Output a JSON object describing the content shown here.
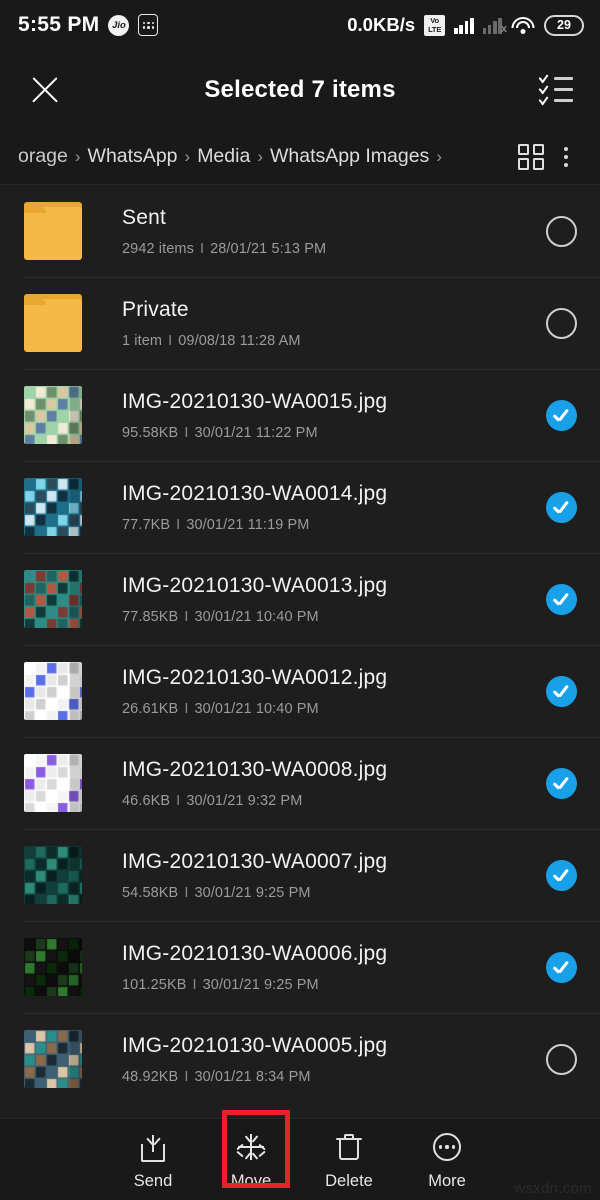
{
  "status_bar": {
    "time": "5:55 PM",
    "carrier_logo": "Jio",
    "dotgrid_icon": "dot-grid-icon",
    "network_speed": "0.0KB/s",
    "volte_line1": "Vo",
    "volte_line2": "LTE",
    "sim2_x": "x",
    "battery_level": "29"
  },
  "app_bar": {
    "close_label": "close-icon",
    "title": "Selected 7 items",
    "select_all_label": "select-all-icon"
  },
  "breadcrumb": {
    "items": [
      {
        "label": "orage"
      },
      {
        "label": "WhatsApp"
      },
      {
        "label": "Media"
      },
      {
        "label": "WhatsApp Images"
      }
    ],
    "separator": "›",
    "grid_view_label": "grid-view-icon",
    "overflow_label": "overflow-menu-icon"
  },
  "list": {
    "rows": [
      {
        "type": "folder",
        "name": "Sent",
        "size": "2942 items",
        "date": "28/01/21 5:13 PM",
        "selected": false
      },
      {
        "type": "folder",
        "name": "Private",
        "size": "1 item",
        "date": "09/08/18 11:28 AM",
        "selected": false
      },
      {
        "type": "image",
        "name": "IMG-20210130-WA0015.jpg",
        "size": "95.58KB",
        "date": "30/01/21 11:22 PM",
        "selected": true
      },
      {
        "type": "image",
        "name": "IMG-20210130-WA0014.jpg",
        "size": "77.7KB",
        "date": "30/01/21 11:19 PM",
        "selected": true
      },
      {
        "type": "image",
        "name": "IMG-20210130-WA0013.jpg",
        "size": "77.85KB",
        "date": "30/01/21 10:40 PM",
        "selected": true
      },
      {
        "type": "image",
        "name": "IMG-20210130-WA0012.jpg",
        "size": "26.61KB",
        "date": "30/01/21 10:40 PM",
        "selected": true
      },
      {
        "type": "image",
        "name": "IMG-20210130-WA0008.jpg",
        "size": "46.6KB",
        "date": "30/01/21 9:32 PM",
        "selected": true
      },
      {
        "type": "image",
        "name": "IMG-20210130-WA0007.jpg",
        "size": "54.58KB",
        "date": "30/01/21 9:25 PM",
        "selected": true
      },
      {
        "type": "image",
        "name": "IMG-20210130-WA0006.jpg",
        "size": "101.25KB",
        "date": "30/01/21 9:25 PM",
        "selected": true
      },
      {
        "type": "image",
        "name": "IMG-20210130-WA0005.jpg",
        "size": "48.92KB",
        "date": "30/01/21 8:34 PM",
        "selected": false
      }
    ],
    "separator": "I"
  },
  "bottom_bar": {
    "tools": [
      {
        "label": "Send",
        "icon": "share-icon",
        "highlighted": false
      },
      {
        "label": "Move",
        "icon": "move-icon",
        "highlighted": true
      },
      {
        "label": "Delete",
        "icon": "trash-icon",
        "highlighted": false
      },
      {
        "label": "More",
        "icon": "more-icon",
        "highlighted": false
      }
    ]
  },
  "watermark": "wsxdn.com",
  "colors": {
    "accent_blue": "#18a0e8",
    "folder_amber": "#f5b945",
    "highlight_red": "#e8222a",
    "bar_background": "#191919",
    "list_background": "#1e1e1e"
  }
}
